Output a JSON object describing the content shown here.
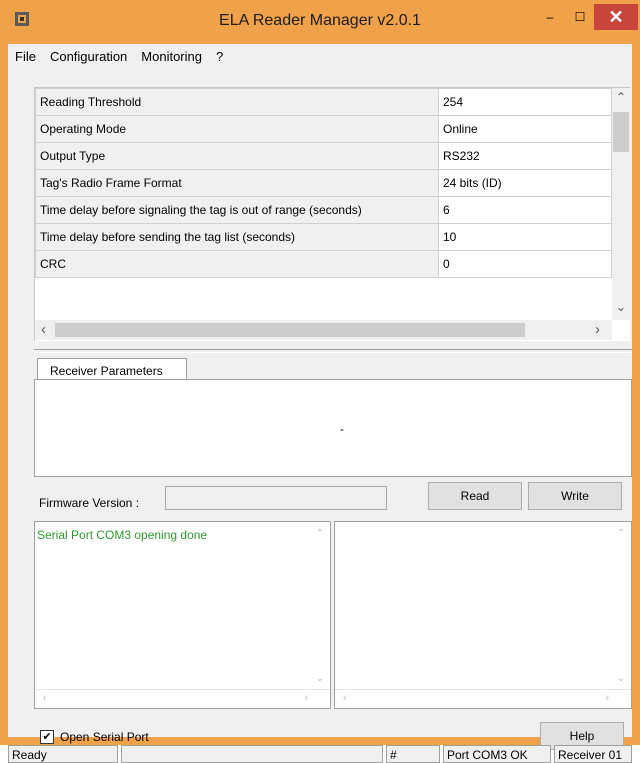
{
  "window": {
    "title": "ELA Reader Manager v2.0.1",
    "minimize_glyph": "‒",
    "maximize_glyph": "☐",
    "close_glyph": "✕"
  },
  "menu": [
    "File",
    "Configuration",
    "Monitoring",
    "?"
  ],
  "parameters": [
    {
      "name": "Reading Threshold",
      "value": "254"
    },
    {
      "name": "Operating Mode",
      "value": "Online"
    },
    {
      "name": "Output Type",
      "value": "RS232"
    },
    {
      "name": "Tag's Radio Frame Format",
      "value": "24 bits (ID)"
    },
    {
      "name": "Time delay before signaling the tag is out of range (seconds)",
      "value": "6"
    },
    {
      "name": "Time delay before sending the tag list (seconds)",
      "value": "10"
    },
    {
      "name": "CRC",
      "value": "0"
    }
  ],
  "scroll": {
    "up": "⌃",
    "down": "⌄",
    "left": "‹",
    "right": "›"
  },
  "tabs": {
    "receiver_parameters": "Receiver Parameters",
    "panel_text": "-"
  },
  "firmware": {
    "label": "Firmware Version :",
    "value": ""
  },
  "buttons": {
    "read": "Read",
    "write": "Write",
    "help": "Help"
  },
  "log": {
    "left_text": "Serial Port COM3 opening done",
    "right_text": ""
  },
  "checkbox": {
    "label": "Open Serial Port",
    "checked": true,
    "mark": "✔"
  },
  "status": {
    "state": "Ready",
    "progress": "",
    "hash": "#",
    "port": "Port COM3 OK",
    "receiver": "Receiver 01"
  },
  "colors": {
    "titlebar": "#f0a24a",
    "close": "#c7453a",
    "log_text": "#2e9b2e"
  }
}
